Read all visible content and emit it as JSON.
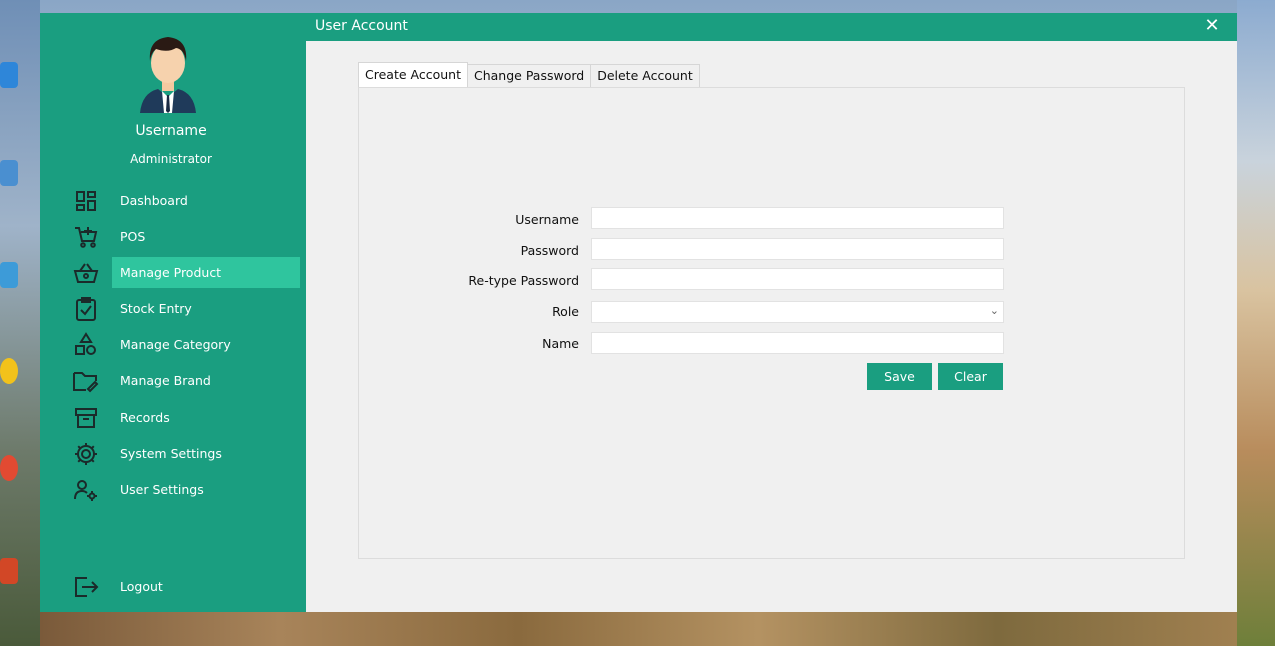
{
  "window": {
    "title": "User Account",
    "close_glyph": "✕"
  },
  "sidebar": {
    "username": "Username",
    "role": "Administrator",
    "items": [
      {
        "label": "Dashboard",
        "icon": "dashboard-icon"
      },
      {
        "label": "POS",
        "icon": "cart-icon"
      },
      {
        "label": "Manage Product",
        "icon": "basket-icon",
        "active": true
      },
      {
        "label": "Stock Entry",
        "icon": "clipboard-check-icon"
      },
      {
        "label": "Manage Category",
        "icon": "shapes-icon"
      },
      {
        "label": "Manage Brand",
        "icon": "folder-edit-icon"
      },
      {
        "label": "Records",
        "icon": "archive-icon"
      },
      {
        "label": "System Settings",
        "icon": "gear-icon"
      },
      {
        "label": "User Settings",
        "icon": "user-settings-icon"
      }
    ],
    "logout": {
      "label": "Logout",
      "icon": "logout-icon"
    }
  },
  "tabs": [
    {
      "label": "Create Account",
      "active": true
    },
    {
      "label": "Change Password"
    },
    {
      "label": "Delete Account"
    }
  ],
  "form": {
    "username_label": "Username",
    "username_value": "",
    "password_label": "Password",
    "password_value": "",
    "retype_label": "Re-type Password",
    "retype_value": "",
    "role_label": "Role",
    "role_value": "",
    "name_label": "Name",
    "name_value": "",
    "save_label": "Save",
    "clear_label": "Clear"
  },
  "colors": {
    "accent": "#1a9e80",
    "active_item": "#2fc59e"
  }
}
